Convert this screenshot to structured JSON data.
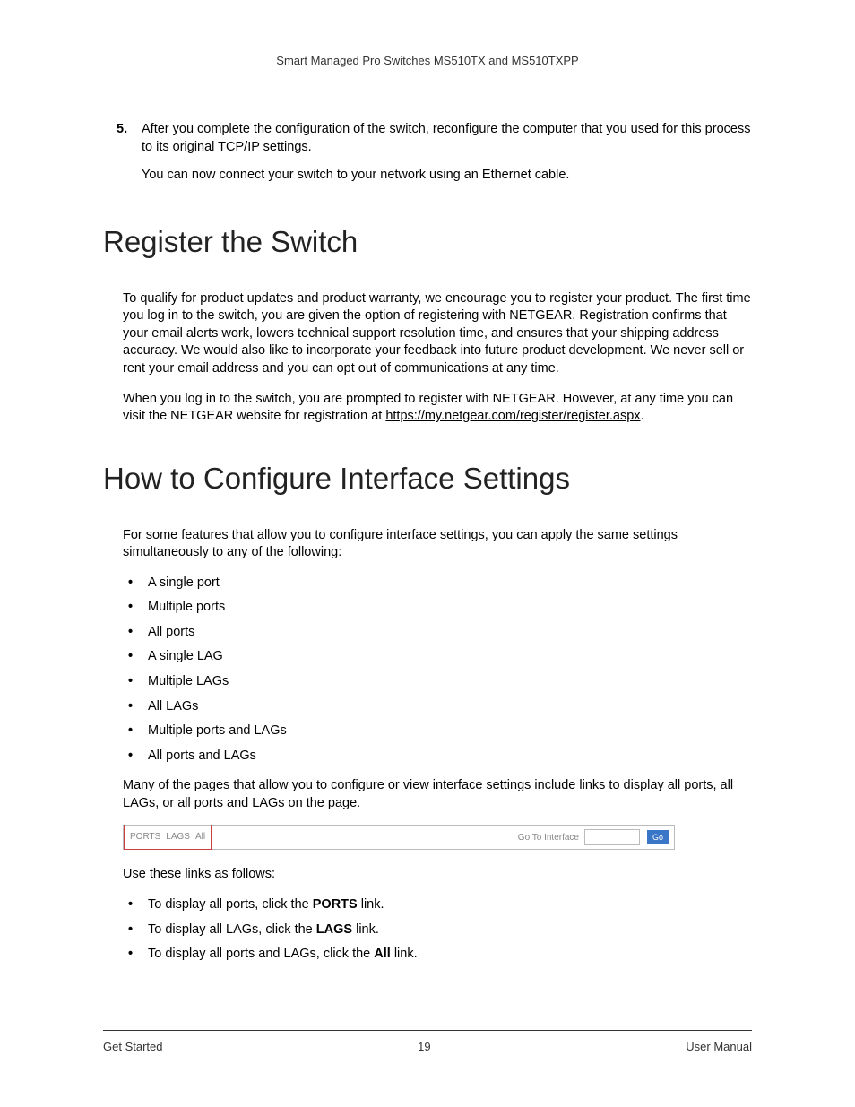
{
  "header": "Smart Managed Pro Switches MS510TX and MS510TXPP",
  "step5": {
    "num": "5.",
    "text": "After you complete the configuration of the switch, reconfigure the computer that you used for this process to its original TCP/IP settings.",
    "sub": "You can now connect your switch to your network using an Ethernet cable."
  },
  "section1": {
    "title": "Register the Switch",
    "p1": "To qualify for product updates and product warranty, we encourage you to register your product. The first time you log in to the switch, you are given the option of registering with NETGEAR. Registration confirms that your email alerts work, lowers technical support resolution time, and ensures that your shipping address accuracy. We would also like to incorporate your feedback into future product development. We never sell or rent your email address and you can opt out of communications at any time.",
    "p2a": "When you log in to the switch, you are prompted to register with NETGEAR. However, at any time you can visit the NETGEAR website for registration at ",
    "p2link": "https://my.netgear.com/register/register.aspx",
    "p2b": "."
  },
  "section2": {
    "title": "How to Configure Interface Settings",
    "intro": "For some features that allow you to configure interface settings, you can apply the same settings simultaneously to any of the following:",
    "bullets": [
      "A single port",
      "Multiple ports",
      "All ports",
      "A single LAG",
      "Multiple LAGs",
      "All LAGs",
      "Multiple ports and LAGs",
      "All ports and LAGs"
    ],
    "para2": "Many of the pages that allow you to configure or view interface settings include links to display all ports, all LAGs, or all ports and LAGs on the page.",
    "fig": {
      "tabs": [
        "PORTS",
        "LAGS",
        "All"
      ],
      "label": "Go To Interface",
      "button": "Go"
    },
    "para3": "Use these links as follows:",
    "bullets2": [
      {
        "pre": "To display all ports, click the ",
        "bold": "PORTS",
        "post": " link."
      },
      {
        "pre": "To display all LAGs, click the ",
        "bold": "LAGS",
        "post": " link."
      },
      {
        "pre": "To display all ports and LAGs, click the ",
        "bold": "All",
        "post": " link."
      }
    ]
  },
  "footer": {
    "left": "Get Started",
    "center": "19",
    "right": "User Manual"
  }
}
